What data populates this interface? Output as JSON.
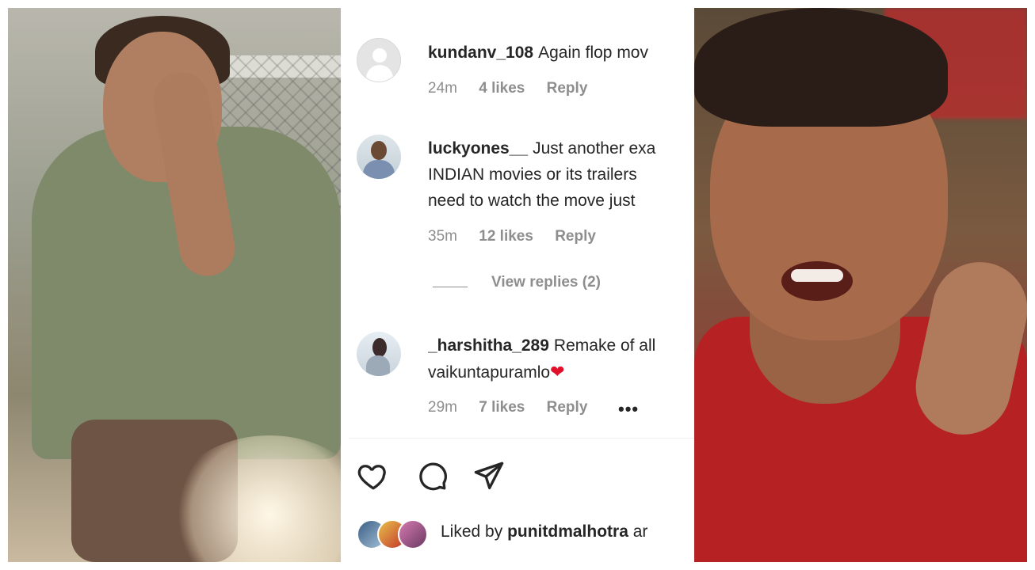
{
  "comments": [
    {
      "username": "kundanv_108",
      "text_lines": [
        "Again flop mov"
      ],
      "time": "24m",
      "likes": "4 likes",
      "reply": "Reply"
    },
    {
      "username": "luckyones__",
      "text_lines": [
        "Just another exa",
        "INDIAN movies or its trailers",
        "need to watch the move just"
      ],
      "time": "35m",
      "likes": "12 likes",
      "reply": "Reply",
      "view_replies": "View replies (2)"
    },
    {
      "username": "_harshitha_289",
      "text_lines": [
        "Remake of all",
        "vaikuntapuramlo"
      ],
      "emoji": "❤",
      "time": "29m",
      "likes": "7 likes",
      "reply": "Reply",
      "more": "•••"
    }
  ],
  "actions": {
    "like_icon": "heart-icon",
    "comment_icon": "comment-bubble-icon",
    "share_icon": "paper-plane-icon"
  },
  "liked_by": {
    "prefix": "Liked by",
    "user": "punitdmalhotra",
    "suffix": "ar"
  },
  "colors": {
    "text": "#262626",
    "muted": "#8e8e8e",
    "heart": "#e0102b"
  }
}
